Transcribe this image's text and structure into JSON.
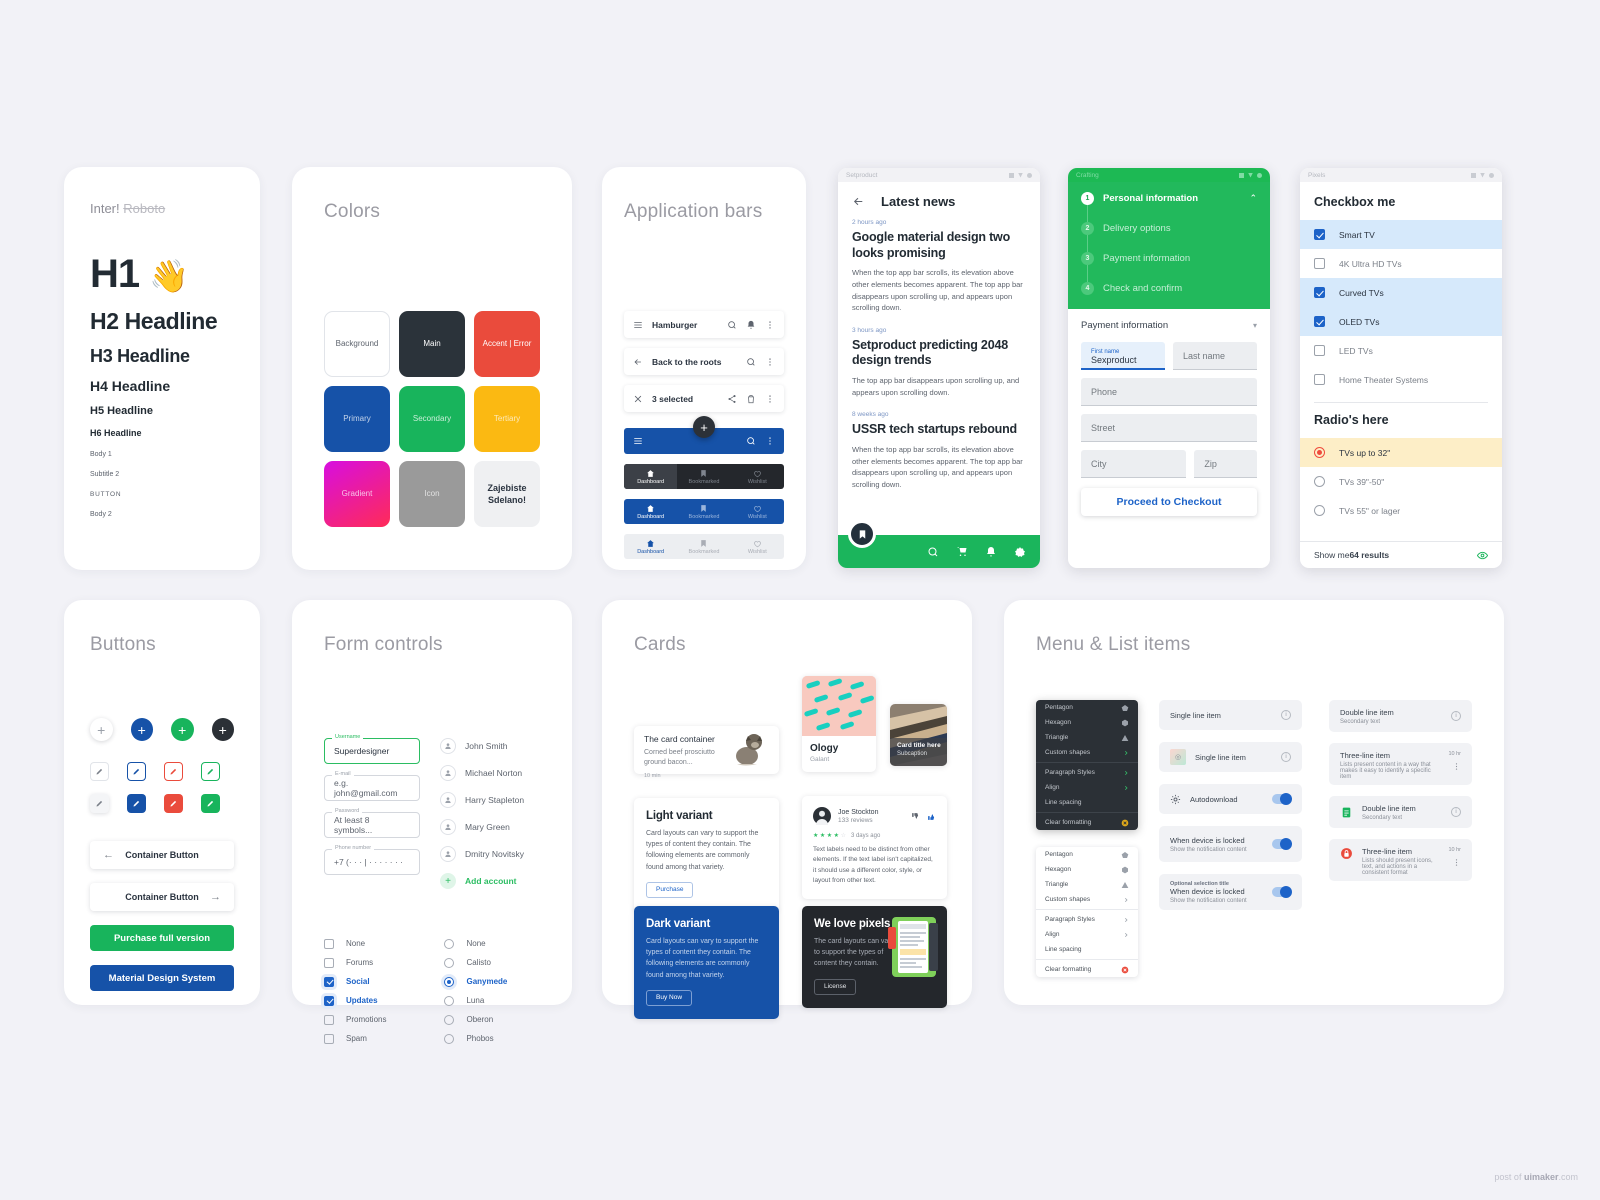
{
  "typography": {
    "font_note_active": "Inter!",
    "font_note_struck": "Roboto",
    "h1": "H1",
    "wave_icon": "wave-hand-emoji",
    "h2": "H2 Headline",
    "h3": "H3 Headline",
    "h4": "H4 Headline",
    "h5": "H5 Headline",
    "h6": "H6 Headline",
    "body1": "Body 1",
    "subtitle2": "Subtitle 2",
    "button": "BUTTON",
    "body2": "Body 2"
  },
  "colors": {
    "title": "Colors",
    "swatches": [
      {
        "label": "Background",
        "hex": "#ffffff",
        "text": "#5e646e",
        "border": true
      },
      {
        "label": "Main",
        "hex": "#2b333a",
        "text": "#ffffff"
      },
      {
        "label": "Accent | Error",
        "hex": "#ea4b3c",
        "text": "#ffffff"
      },
      {
        "label": "Primary",
        "hex": "#1652a8",
        "text": "#c5d4ea"
      },
      {
        "label": "Secondary",
        "hex": "#18b45c",
        "text": "#c9eed8"
      },
      {
        "label": "Tertiary",
        "hex": "#fbb912",
        "text": "#fdeabb"
      },
      {
        "label": "Gradient",
        "hex": "#e410d8",
        "text": "#f8c3e8"
      },
      {
        "label": "Icon",
        "hex": "#9a9a9a",
        "text": "#e2e2e2"
      },
      {
        "label": "Zajebiste Sdelano!",
        "hex": "#eff0f2",
        "text": "#2b3440"
      }
    ]
  },
  "appbars": {
    "title": "Application bars",
    "bars": [
      {
        "label": "Hamburger",
        "leading": "hamburger-icon",
        "actions": [
          "search-icon",
          "bell-icon",
          "overflow-icon"
        ]
      },
      {
        "label": "Back to the roots",
        "leading": "arrow-back-icon",
        "actions": [
          "search-icon",
          "overflow-icon"
        ]
      },
      {
        "label": "3 selected",
        "leading": "close-icon",
        "actions": [
          "share-icon",
          "delete-icon",
          "overflow-icon"
        ]
      }
    ],
    "blue_bar": {
      "leading": "hamburger-icon",
      "actions": [
        "search-icon",
        "overflow-icon"
      ],
      "fab": "+"
    },
    "navitems": [
      "Dashboard",
      "Bookmarked",
      "Wishlist"
    ]
  },
  "news_phone": {
    "window_title": "Setproduct",
    "back_icon": "arrow-back-icon",
    "header": "Latest news",
    "articles": [
      {
        "time": "2 hours ago",
        "title": "Google material design two looks promising",
        "text": "When the top app bar scrolls, its elevation above other elements becomes apparent. The top app bar disappears upon scrolling up, and appears upon scrolling down."
      },
      {
        "time": "3 hours ago",
        "title": "Setproduct predicting 2048 design trends",
        "text": "The top app bar disappears upon scrolling up, and appears upon scrolling down."
      },
      {
        "time": "8 weeks ago",
        "title": "USSR tech startups rebound",
        "text": "When the top app bar scrolls, its elevation above other elements becomes apparent. The top app bar disappears upon scrolling up, and appears upon scrolling down."
      }
    ],
    "fab_icon": "bookmark-icon",
    "bottom_actions": [
      "search-icon",
      "cart-icon",
      "bell-icon",
      "gear-icon"
    ],
    "bar_color": "#1bb55c"
  },
  "checkout_phone": {
    "window_title": "Crafting",
    "steps": [
      {
        "num": "1",
        "label": "Personal information",
        "active": true
      },
      {
        "num": "2",
        "label": "Delivery options",
        "active": false
      },
      {
        "num": "3",
        "label": "Payment information",
        "active": false
      },
      {
        "num": "4",
        "label": "Check and confirm",
        "active": false
      }
    ],
    "section_label": "Payment information",
    "chevron": "chevron-down-icon",
    "fields": {
      "first_name_label": "First name",
      "first_name_value": "Sexproduct",
      "last_name": "Last name",
      "phone": "Phone",
      "street": "Street",
      "city": "City",
      "zip": "Zip"
    },
    "cta": "Proceed to Checkout",
    "accent": "#22b95c"
  },
  "checkbox_phone": {
    "window_title": "Pixels",
    "checkbox_title": "Checkbox me",
    "checkboxes": [
      {
        "label": "Smart TV",
        "checked": true
      },
      {
        "label": "4K Ultra HD TVs",
        "checked": false
      },
      {
        "label": "Curved TVs",
        "checked": true
      },
      {
        "label": "OLED TVs",
        "checked": true
      },
      {
        "label": "LED TVs",
        "checked": false
      },
      {
        "label": "Home Theater Systems",
        "checked": false
      }
    ],
    "radio_title": "Radio's here",
    "radios": [
      {
        "label": "TVs up to 32\"",
        "checked": true
      },
      {
        "label": "TVs 39\"-50\"",
        "checked": false
      },
      {
        "label": "TVs 55\" or lager",
        "checked": false
      }
    ],
    "footer_prefix": "Show me ",
    "footer_strong": "64 results",
    "footer_icon": "eye-icon"
  },
  "buttons": {
    "title": "Buttons",
    "fabs": [
      {
        "name": "fab-white",
        "bg": "#ffffff",
        "fg": "#9ba1aa"
      },
      {
        "name": "fab-blue",
        "bg": "#1652a8",
        "fg": "#ffffff"
      },
      {
        "name": "fab-green",
        "bg": "#18b45c",
        "fg": "#ffffff"
      },
      {
        "name": "fab-dark",
        "bg": "#2b3036",
        "fg": "#ffffff"
      }
    ],
    "fab_glyph": "+",
    "outlined": [
      {
        "name": "icon-outlined-grey",
        "border": "#e1e4e9",
        "fg": "#7b8089"
      },
      {
        "name": "icon-outlined-blue",
        "border": "#1652a8",
        "fg": "#1652a8"
      },
      {
        "name": "icon-outlined-red",
        "border": "#ea4b3c",
        "fg": "#ea4b3c"
      },
      {
        "name": "icon-outlined-green",
        "border": "#18b45c",
        "fg": "#18b45c"
      }
    ],
    "filled": [
      {
        "name": "icon-filled-white",
        "bg": "#f4f5f7",
        "fg": "#7b8089"
      },
      {
        "name": "icon-filled-blue",
        "bg": "#1652a8",
        "fg": "#ffffff"
      },
      {
        "name": "icon-filled-red",
        "bg": "#ea4b3c",
        "fg": "#ffffff"
      },
      {
        "name": "icon-filled-green",
        "bg": "#18b45c",
        "fg": "#ffffff"
      }
    ],
    "pencil_icon": "pencil-icon",
    "container_back": {
      "label": "Container Button",
      "icon": "arrow-left-icon"
    },
    "container_fwd": {
      "label": "Container Button",
      "icon": "arrow-right-icon"
    },
    "purchase": {
      "label": "Purchase full version",
      "bg": "#18b45c"
    },
    "mds": {
      "label": "Material Design System",
      "bg": "#1652a8"
    }
  },
  "form": {
    "title": "Form controls",
    "fields": [
      {
        "label": "Username",
        "value": "Superdesigner",
        "focused": true
      },
      {
        "label": "E-mail",
        "value": "e.g. john@gmail.com",
        "focused": false
      },
      {
        "label": "Password",
        "value": "At least 8 symbols...",
        "focused": false
      },
      {
        "label": "Phone number",
        "value": "+7 (· · · | · · · · · · ·",
        "focused": false
      }
    ],
    "accounts": [
      "John Smith",
      "Michael Norton",
      "Harry Stapleton",
      "Mary Green",
      "Dmitry Novitsky"
    ],
    "add_account": "Add account",
    "add_icon": "plus-icon",
    "checkboxes": [
      {
        "label": "None",
        "checked": false
      },
      {
        "label": "Forums",
        "checked": false
      },
      {
        "label": "Social",
        "checked": true
      },
      {
        "label": "Updates",
        "checked": true
      },
      {
        "label": "Promotions",
        "checked": false
      },
      {
        "label": "Spam",
        "checked": false
      }
    ],
    "radios": [
      {
        "label": "None",
        "checked": false
      },
      {
        "label": "Calisto",
        "checked": false
      },
      {
        "label": "Ganymede",
        "checked": true
      },
      {
        "label": "Luna",
        "checked": false
      },
      {
        "label": "Oberon",
        "checked": false
      },
      {
        "label": "Phobos",
        "checked": false
      }
    ]
  },
  "cards": {
    "title": "Cards",
    "container": {
      "title": "The card container",
      "sub": "Corned beef prosciutto ground bacon...",
      "meta": "10 min"
    },
    "ology": {
      "title": "Ology",
      "sub": "Galant"
    },
    "overlay": {
      "title": "Card title here",
      "sub": "Subcaption"
    },
    "light": {
      "title": "Light variant",
      "text": "Card layouts can vary to support the types of content they contain. The following elements are commonly found among that variety.",
      "button": "Purchase"
    },
    "review": {
      "name": "Joe Stockton",
      "reviews": "133 reviews",
      "rating": 3.5,
      "age": "3 days ago",
      "text": "Text labels need to be distinct from other elements. If the text label isn't capitalized, it should use a different color, style, or layout from other text.",
      "down_icon": "thumb-down-icon",
      "up_icon": "thumb-up-icon"
    },
    "dark": {
      "title": "Dark variant",
      "text": "Card layouts can vary to support the types of content they contain. The following elements are commonly found among that variety.",
      "button": "Buy Now"
    },
    "pixels": {
      "title": "We love pixels",
      "text": "The card layouts can vary to support the types of content they contain.",
      "button": "License"
    }
  },
  "menu": {
    "title": "Menu & List items",
    "items": [
      {
        "label": "Pentagon",
        "trail": "pentagon-icon"
      },
      {
        "label": "Hexagon",
        "trail": "hexagon-icon"
      },
      {
        "label": "Triangle",
        "trail": "triangle-icon"
      },
      {
        "label": "Custom shapes",
        "trail": "chevron-right-icon"
      },
      {
        "sep": true
      },
      {
        "label": "Paragraph Styles",
        "trail": "chevron-right-icon"
      },
      {
        "label": "Align",
        "trail": "chevron-right-icon"
      },
      {
        "label": "Line spacing",
        "trail": ""
      },
      {
        "sep": true
      },
      {
        "label": "Clear formatting",
        "trail": "clear-icon"
      }
    ],
    "list_mid": [
      {
        "title": "Single line item",
        "sec": "",
        "lead": "",
        "trail": "info-icon",
        "toggle": false
      },
      {
        "title": "Single line item",
        "sec": "",
        "lead": "thumb-icon",
        "trail": "info-icon",
        "toggle": false
      },
      {
        "title": "Autodownload",
        "sec": "",
        "lead": "gear-icon",
        "trail": "",
        "toggle": true
      },
      {
        "title": "When device is locked",
        "sec": "Show the notification content",
        "lead": "",
        "trail": "",
        "toggle": true
      },
      {
        "overline": "Optional selection title",
        "title": "When device is locked",
        "sec": "Show the notification content",
        "lead": "",
        "trail": "",
        "toggle": true
      }
    ],
    "list_right": [
      {
        "title": "Double line item",
        "sec": "Secondary text",
        "time": "",
        "lead": "",
        "trail": "info-icon"
      },
      {
        "title": "Three-line item",
        "sec": "Lists present content in a way that makes it easy to identify a specific item",
        "time": "10 hr",
        "lead": "",
        "trail": "overflow-icon"
      },
      {
        "title": "Double line item",
        "sec": "Secondary text",
        "time": "",
        "lead": "doc-icon",
        "trail": "info-icon"
      },
      {
        "title": "Three-line item",
        "sec": "Lists should present icons, text, and actions in a consistent format",
        "time": "10 hr",
        "lead": "lock-icon",
        "trail": "overflow-icon"
      }
    ]
  },
  "watermark": {
    "prefix": "post of ",
    "brand": "uimaker",
    "suffix": ".com"
  }
}
